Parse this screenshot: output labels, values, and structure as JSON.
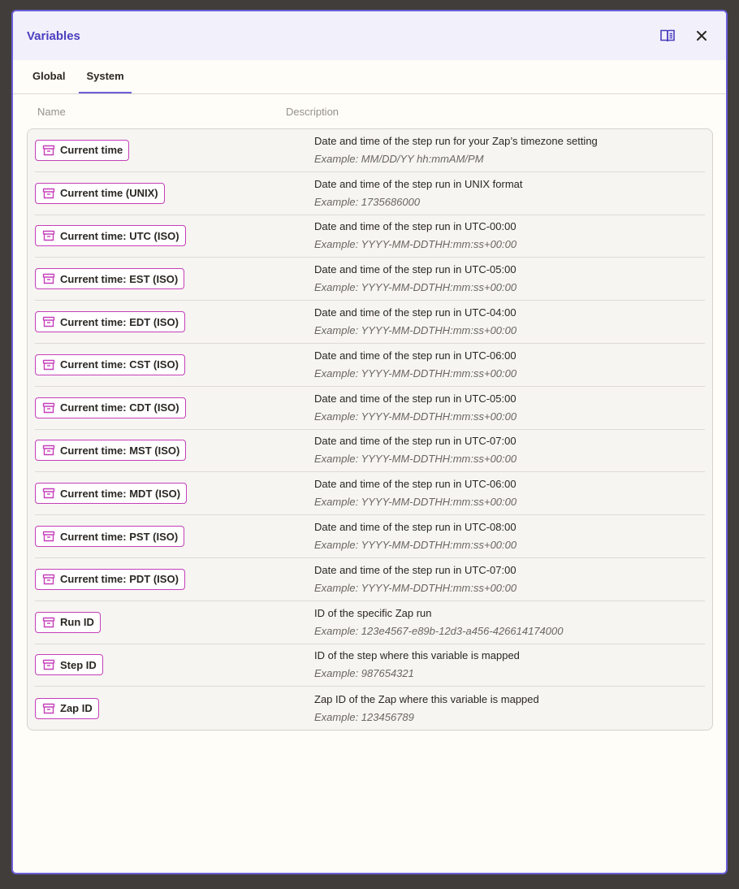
{
  "header": {
    "title": "Variables",
    "docs_icon": "book-open-icon",
    "close_icon": "close-icon"
  },
  "tabs": [
    {
      "label": "Global",
      "active": false
    },
    {
      "label": "System",
      "active": true
    }
  ],
  "columns": {
    "name": "Name",
    "description": "Description"
  },
  "variables": [
    {
      "name": "Current time",
      "description": "Date and time of the step run for your Zap’s timezone setting",
      "example": "Example: MM/DD/YY hh:mmAM/PM"
    },
    {
      "name": "Current time (UNIX)",
      "description": "Date and time of the step run in UNIX format",
      "example": "Example: 1735686000"
    },
    {
      "name": "Current time: UTC (ISO)",
      "description": "Date and time of the step run in UTC-00:00",
      "example": "Example: YYYY-MM-DDTHH:mm:ss+00:00"
    },
    {
      "name": "Current time: EST (ISO)",
      "description": "Date and time of the step run in UTC-05:00",
      "example": "Example: YYYY-MM-DDTHH:mm:ss+00:00"
    },
    {
      "name": "Current time: EDT (ISO)",
      "description": "Date and time of the step run in UTC-04:00",
      "example": "Example: YYYY-MM-DDTHH:mm:ss+00:00"
    },
    {
      "name": "Current time: CST (ISO)",
      "description": "Date and time of the step run in UTC-06:00",
      "example": "Example: YYYY-MM-DDTHH:mm:ss+00:00"
    },
    {
      "name": "Current time: CDT (ISO)",
      "description": "Date and time of the step run in UTC-05:00",
      "example": "Example: YYYY-MM-DDTHH:mm:ss+00:00"
    },
    {
      "name": "Current time: MST (ISO)",
      "description": "Date and time of the step run in UTC-07:00",
      "example": "Example: YYYY-MM-DDTHH:mm:ss+00:00"
    },
    {
      "name": "Current time: MDT (ISO)",
      "description": "Date and time of the step run in UTC-06:00",
      "example": "Example: YYYY-MM-DDTHH:mm:ss+00:00"
    },
    {
      "name": "Current time: PST (ISO)",
      "description": "Date and time of the step run in UTC-08:00",
      "example": "Example: YYYY-MM-DDTHH:mm:ss+00:00"
    },
    {
      "name": "Current time: PDT (ISO)",
      "description": "Date and time of the step run in UTC-07:00",
      "example": "Example: YYYY-MM-DDTHH:mm:ss+00:00"
    },
    {
      "name": "Run ID",
      "description": "ID of the specific Zap run",
      "example": "Example: 123e4567-e89b-12d3-a456-426614174000"
    },
    {
      "name": "Step ID",
      "description": "ID of the step where this variable is mapped",
      "example": "Example: 987654321"
    },
    {
      "name": "Zap ID",
      "description": "Zap ID of the Zap where this variable is mapped",
      "example": "Example: 123456789"
    }
  ],
  "variable_icon": "archive-box-icon",
  "colors": {
    "accent": "#6a5fd6",
    "pill_border": "#c53fba",
    "title": "#4b3fbf"
  }
}
